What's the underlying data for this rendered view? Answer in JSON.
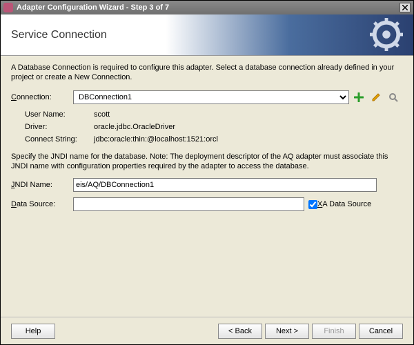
{
  "window": {
    "title": "Adapter Configuration Wizard - Step 3 of 7"
  },
  "banner": {
    "heading": "Service Connection"
  },
  "intro": "A Database Connection is required to configure this adapter. Select a database connection already defined in your project or create a New Connection.",
  "connection": {
    "label_pre": "C",
    "label_post": "onnection:",
    "selected": "DBConnection1",
    "details": {
      "username_label": "User Name:",
      "username_value": "scott",
      "driver_label": "Driver:",
      "driver_value": "oracle.jdbc.OracleDriver",
      "connectstr_label": "Connect String:",
      "connectstr_value": "jdbc:oracle:thin:@localhost:1521:orcl"
    }
  },
  "jndi_note": "Specify the JNDI name for the database.  Note: The deployment descriptor of the AQ adapter must associate this JNDI name with configuration properties required by the adapter to access the database.",
  "jndi": {
    "label_pre": "J",
    "label_post": "NDI Name:",
    "value": "eis/AQ/DBConnection1"
  },
  "datasource": {
    "label_pre": "D",
    "label_post": "ata Source:",
    "value": "",
    "xa_label_pre": "X",
    "xa_label_post": "A Data Source",
    "xa_checked": true
  },
  "footer": {
    "help": "Help",
    "back": "< Back",
    "next": "Next >",
    "finish": "Finish",
    "cancel": "Cancel"
  }
}
